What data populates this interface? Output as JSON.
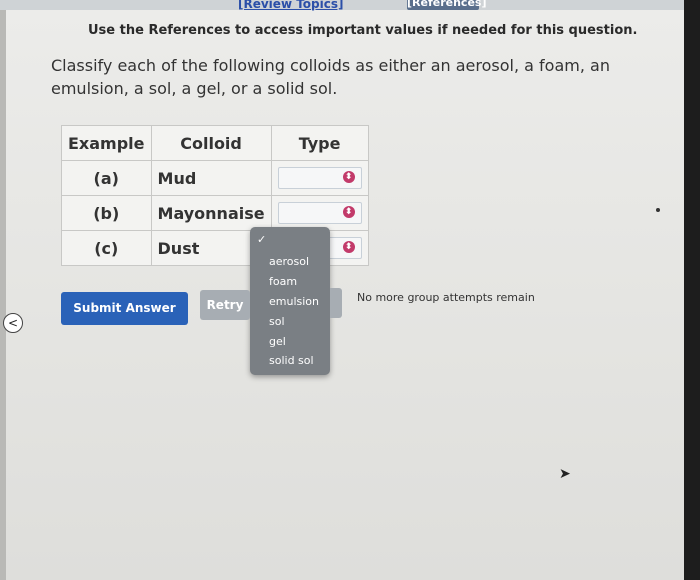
{
  "header": {
    "review_topics": "[Review Topics]",
    "references": "[References]"
  },
  "notice": "Use the References to access important values if needed for this question.",
  "question": "Classify each of the following colloids as either an aerosol, a foam, an emulsion, a sol, a gel, or a solid sol.",
  "table": {
    "headers": [
      "Example",
      "Colloid",
      "Type"
    ],
    "rows": [
      {
        "example": "(a)",
        "colloid": "Mud",
        "type": ""
      },
      {
        "example": "(b)",
        "colloid": "Mayonnaise",
        "type": ""
      },
      {
        "example": "(c)",
        "colloid": "Dust",
        "type": ""
      }
    ]
  },
  "dropdown": {
    "check": "✓",
    "options": [
      "aerosol",
      "foam",
      "emulsion",
      "sol",
      "gel",
      "solid sol"
    ]
  },
  "buttons": {
    "submit": "Submit Answer",
    "retry": "Retry"
  },
  "status": "No more group attempts remain",
  "icons": {
    "back": "chevron-left-icon",
    "select": "select-arrow-icon",
    "cursor": "mouse-pointer-icon"
  },
  "colors": {
    "submit": "#2a62b8",
    "retry": "#a7adb3",
    "select_icon": "#c23a6a",
    "link": "#2b4fa8"
  }
}
